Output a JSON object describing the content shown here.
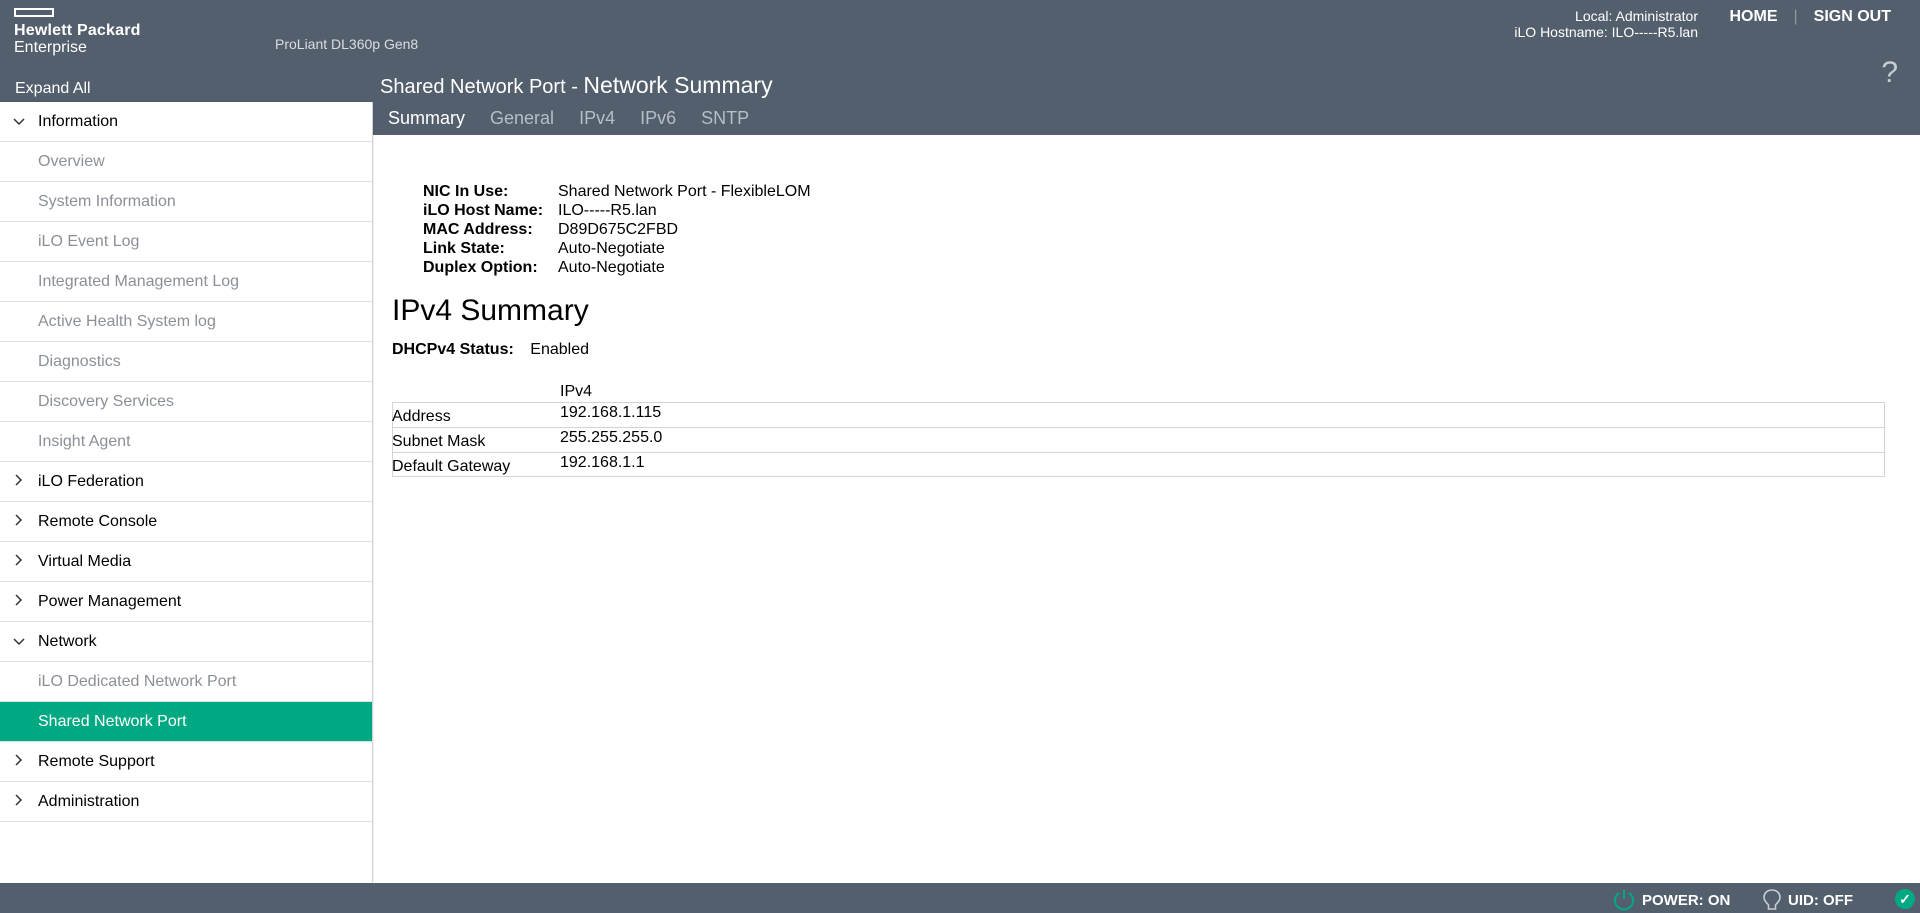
{
  "header": {
    "logo_line1": "Hewlett Packard",
    "logo_line2": "Enterprise",
    "server_model": "ProLiant DL360p Gen8",
    "user": "Local: Administrator",
    "hostname": "iLO Hostname: ILO-----R5.lan",
    "home_label": "HOME",
    "signout_label": "SIGN OUT",
    "help_symbol": "?",
    "expand_all": "Expand All",
    "title_prefix": "Shared Network Port - ",
    "title_main": "Network Summary"
  },
  "tabs": [
    {
      "label": "Summary",
      "active": true
    },
    {
      "label": "General",
      "active": false
    },
    {
      "label": "IPv4",
      "active": false
    },
    {
      "label": "IPv6",
      "active": false
    },
    {
      "label": "SNTP",
      "active": false
    }
  ],
  "sidebar": {
    "items": [
      {
        "label": "Information",
        "type": "section",
        "expanded": true
      },
      {
        "label": "Overview",
        "type": "child"
      },
      {
        "label": "System Information",
        "type": "child"
      },
      {
        "label": "iLO Event Log",
        "type": "child"
      },
      {
        "label": "Integrated Management Log",
        "type": "child"
      },
      {
        "label": "Active Health System log",
        "type": "child"
      },
      {
        "label": "Diagnostics",
        "type": "child"
      },
      {
        "label": "Discovery Services",
        "type": "child"
      },
      {
        "label": "Insight Agent",
        "type": "child"
      },
      {
        "label": "iLO Federation",
        "type": "section",
        "expanded": false
      },
      {
        "label": "Remote Console",
        "type": "section",
        "expanded": false
      },
      {
        "label": "Virtual Media",
        "type": "section",
        "expanded": false
      },
      {
        "label": "Power Management",
        "type": "section",
        "expanded": false
      },
      {
        "label": "Network",
        "type": "section",
        "expanded": true
      },
      {
        "label": "iLO Dedicated Network Port",
        "type": "child"
      },
      {
        "label": "Shared Network Port",
        "type": "child",
        "active": true
      },
      {
        "label": "Remote Support",
        "type": "section",
        "expanded": false
      },
      {
        "label": "Administration",
        "type": "section",
        "expanded": false
      }
    ]
  },
  "nic": {
    "rows": [
      {
        "label": "NIC In Use:",
        "value": "Shared Network Port - FlexibleLOM"
      },
      {
        "label": "iLO Host Name:",
        "value": "ILO-----R5.lan"
      },
      {
        "label": "MAC Address:",
        "value": "D89D675C2FBD"
      },
      {
        "label": "Link State:",
        "value": "Auto-Negotiate"
      },
      {
        "label": "Duplex Option:",
        "value": "Auto-Negotiate"
      }
    ]
  },
  "ipv4_summary": {
    "title": "IPv4 Summary",
    "dhcp_label": "DHCPv4 Status:",
    "dhcp_value": "Enabled",
    "column_header": "IPv4",
    "rows": [
      {
        "label": "Address",
        "value": "192.168.1.115"
      },
      {
        "label": "Subnet Mask",
        "value": "255.255.255.0"
      },
      {
        "label": "Default Gateway",
        "value": "192.168.1.1"
      }
    ]
  },
  "footer": {
    "power": "POWER: ON",
    "uid": "UID: OFF",
    "accent_color": "#01a982"
  }
}
